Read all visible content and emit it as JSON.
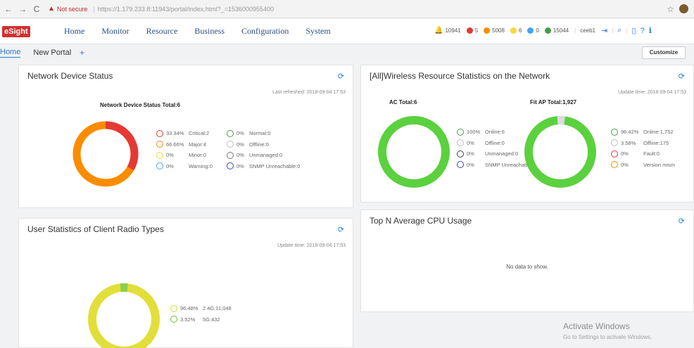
{
  "browser": {
    "back": "←",
    "forward": "→",
    "reload": "C",
    "not_secure": "Not secure",
    "url": "https://1.179.233.8:11943/portal/index.html?_=1536000955400",
    "star": "☆"
  },
  "header": {
    "logo_text": "Sight",
    "logo_prefix": "e",
    "menu": [
      "Home",
      "Monitor",
      "Resource",
      "Business",
      "Configuration",
      "System"
    ],
    "alarms": [
      {
        "count": "10941",
        "color": "#f5a623",
        "icon": "bell-icon"
      },
      {
        "count": "5",
        "color": "#e53935",
        "icon": "critical-alarm-icon"
      },
      {
        "count": "5008",
        "color": "#fb8c00",
        "icon": "major-alarm-icon"
      },
      {
        "count": "6",
        "color": "#fdd835",
        "icon": "minor-alarm-icon"
      },
      {
        "count": "0",
        "color": "#42a5f5",
        "icon": "warning-alarm-icon"
      },
      {
        "count": "15044",
        "color": "#43a047",
        "icon": "cleared-alarm-icon"
      }
    ],
    "user": "ceeb1"
  },
  "subtabs": {
    "home": "Home",
    "new_portal": "New Portal",
    "add": "+",
    "customize": "Customize"
  },
  "panels": {
    "network_device": {
      "title": "Network Device Status",
      "updated": "Last refreshed: 2018-09-04 17:53",
      "chart_title": "Network Device Status Total:6",
      "legend": [
        {
          "pct": "33.34%",
          "label": "Critical:2",
          "color": "#e53935"
        },
        {
          "pct": "66.66%",
          "label": "Major:4",
          "color": "#fb8c00"
        },
        {
          "pct": "0%",
          "label": "Minor:0",
          "color": "#fdd835"
        },
        {
          "pct": "0%",
          "label": "Warning:0",
          "color": "#42a5f5"
        },
        {
          "pct": "0%",
          "label": "Normal:0",
          "color": "#43a047"
        },
        {
          "pct": "0%",
          "label": "Offline:0",
          "color": "#bdbdbd"
        },
        {
          "pct": "0%",
          "label": "Unmanaged:0",
          "color": "#757575"
        },
        {
          "pct": "0%",
          "label": "SNMP Unreachable:0",
          "color": "#3949ab"
        }
      ]
    },
    "wireless": {
      "title": "[All]Wireless Resource Statistics on the Network",
      "updated": "Update time: 2018-09-04 17:53",
      "ac_title": "AC Total:6",
      "fitap_title": "Fit AP Total:1,927",
      "ac_legend": [
        {
          "pct": "100%",
          "label": "Online:6",
          "color": "#43a047"
        },
        {
          "pct": "0%",
          "label": "Offline:0",
          "color": "#bdbdbd"
        },
        {
          "pct": "0%",
          "label": "Unmanaged:0",
          "color": "#424242"
        },
        {
          "pct": "0%",
          "label": "SNMP Unreachable:0",
          "color": "#3949ab"
        }
      ],
      "ap_legend": [
        {
          "pct": "96.42%",
          "label": "Online:1,752",
          "color": "#43a047"
        },
        {
          "pct": "3.58%",
          "label": "Offline:175",
          "color": "#bdbdbd"
        },
        {
          "pct": "0%",
          "label": "Fault:0",
          "color": "#e53935"
        },
        {
          "pct": "0%",
          "label": "Version mism",
          "color": "#fb8c00"
        }
      ]
    },
    "radio": {
      "title": "User Statistics of Client Radio Types",
      "updated": "Update time: 2018-09-04 17:53",
      "legend": [
        {
          "pct": "96.48%",
          "label": "2.4G:11,048",
          "color": "#cddc39"
        },
        {
          "pct": "3.52%",
          "label": "5G:432",
          "color": "#7cb342"
        }
      ]
    },
    "cpu": {
      "title": "Top N Average CPU Usage",
      "nodata": "No data to show."
    }
  },
  "watermark": {
    "line1": "Activate Windows",
    "line2": "Go to Settings to activate Windows."
  }
}
